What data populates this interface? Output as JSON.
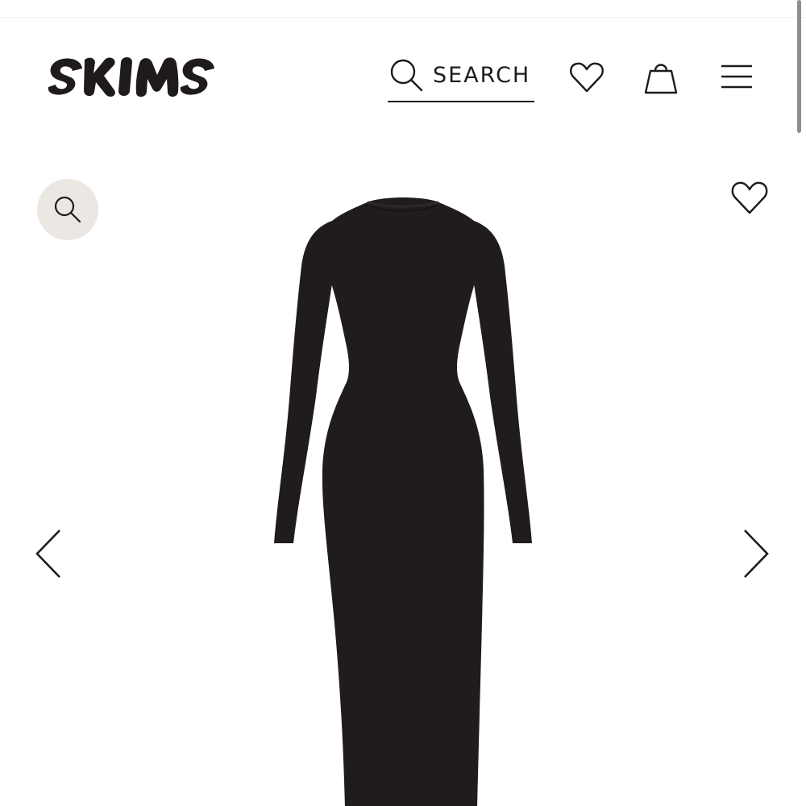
{
  "brand": {
    "name": "SKIMS"
  },
  "header": {
    "search": {
      "label": "SEARCH",
      "icon": "search-icon"
    },
    "wishlist": {
      "icon": "heart-icon"
    },
    "bag": {
      "icon": "shopping-bag-icon"
    },
    "menu": {
      "icon": "hamburger-menu-icon"
    }
  },
  "gallery": {
    "zoom": {
      "icon": "magnifier-icon"
    },
    "favorite": {
      "icon": "heart-outline-icon"
    },
    "prev": {
      "icon": "chevron-left-icon"
    },
    "next": {
      "icon": "chevron-right-icon"
    },
    "product_color": "#201c1e"
  },
  "colors": {
    "text": "#1f1a1c",
    "zoom_button_bg": "#ebe7e2",
    "background": "#ffffff"
  }
}
